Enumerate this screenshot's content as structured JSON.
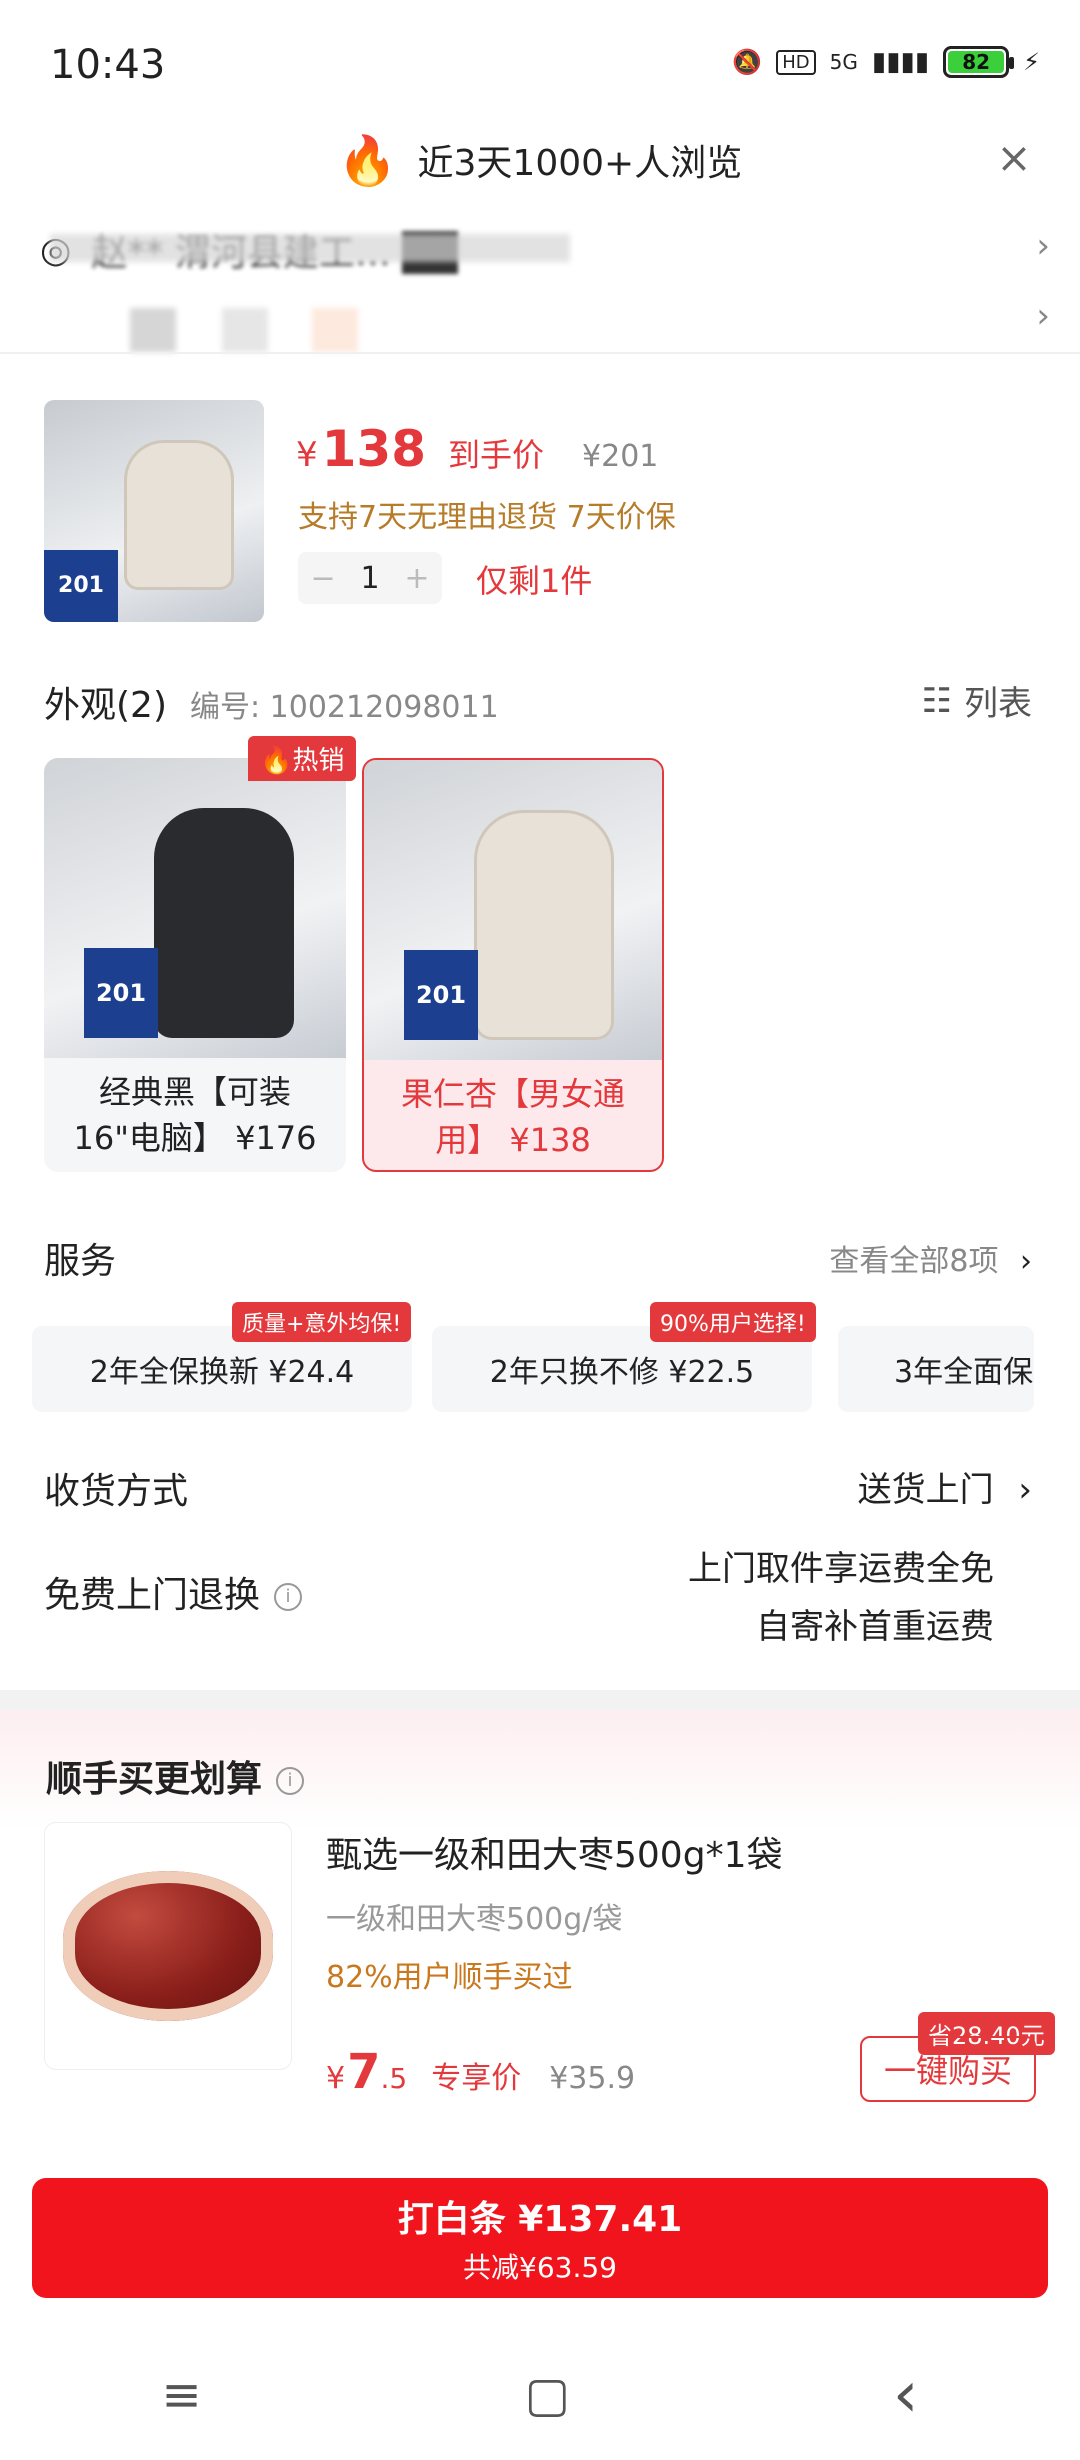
{
  "status_bar": {
    "time": "10:43",
    "network": "5G",
    "hd": "HD",
    "battery": "82"
  },
  "banner": {
    "text": "近3天1000+人浏览",
    "close": "×"
  },
  "address": {
    "text": "赵**   渭河县建工… ██"
  },
  "product": {
    "price_symbol": "¥",
    "price": "138",
    "price_label": "到手价",
    "original_price": "¥201",
    "return_policy": "支持7天无理由退货  7天价保",
    "quantity": "1",
    "minus": "−",
    "plus": "+",
    "stock": "仅剩1件"
  },
  "appearance": {
    "title": "外观(2)",
    "code": "编号: 100212098011",
    "list_label": "列表",
    "hot_tag": "🔥热销",
    "variants": [
      {
        "label": "经典黑【可装16\"电脑】 ¥176",
        "selected": false
      },
      {
        "label": "果仁杏【男女通用】 ¥138",
        "selected": true
      }
    ]
  },
  "services": {
    "title": "服务",
    "more": "查看全部8项",
    "items": [
      {
        "label": "2年全保换新  ¥24.4",
        "badge": "质量+意外均保!"
      },
      {
        "label": "2年只换不修  ¥22.5",
        "badge": "90%用户选择!"
      },
      {
        "label": "3年全面保",
        "badge": ""
      }
    ]
  },
  "delivery": {
    "label": "收货方式",
    "value": "送货上门"
  },
  "free_return": {
    "label": "免费上门退换",
    "line1": "上门取件享运费全免",
    "line2": "自寄补首重运费"
  },
  "upsell": {
    "title": "顺手买更划算",
    "name": "甄选一级和田大枣500g*1袋",
    "spec": "一级和田大枣500g/袋",
    "buyers": "82%用户顺手买过",
    "price_symbol": "¥",
    "price_int": "7",
    "price_dec": ".5",
    "price_label": "专享价",
    "old_price": "¥35.9",
    "save_tag": "省28.40元",
    "buy_label": "一键购买"
  },
  "cta": {
    "line1": "打白条 ¥137.41",
    "line2": "共减¥63.59"
  },
  "nav": {
    "menu": "≡",
    "home": "▢",
    "back": "‹"
  },
  "colors": {
    "accent": "#e4393c",
    "cta": "#f2141d",
    "gold": "#b67c2a"
  }
}
